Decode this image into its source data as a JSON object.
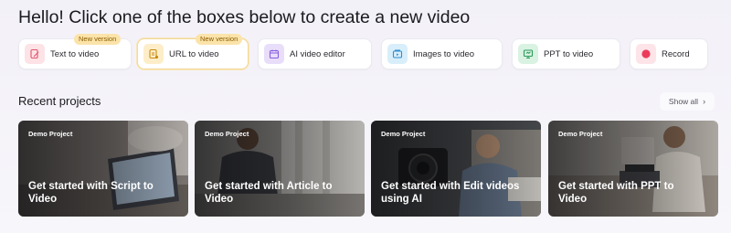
{
  "header": {
    "title": "Hello! Click one of the boxes below to create a new video"
  },
  "actions": [
    {
      "label": "Text to video",
      "icon": "document-pen-icon",
      "badge": "New version"
    },
    {
      "label": "URL to video",
      "icon": "url-document-icon",
      "badge": "New version"
    },
    {
      "label": "AI video editor",
      "icon": "ai-editor-icon"
    },
    {
      "label": "Images to video",
      "icon": "images-icon"
    },
    {
      "label": "PPT to video",
      "icon": "presentation-icon"
    },
    {
      "label": "Record",
      "icon": "record-icon"
    }
  ],
  "recent": {
    "title": "Recent projects",
    "show_all": "Show all",
    "cards": [
      {
        "tag": "Demo Project",
        "title": "Get started with Script to Video"
      },
      {
        "tag": "Demo Project",
        "title": "Get started with Article to Video"
      },
      {
        "tag": "Demo Project",
        "title": "Get started with Edit videos using AI"
      },
      {
        "tag": "Demo Project",
        "title": "Get started with PPT to Video"
      }
    ]
  },
  "colors": {
    "text_icon_bg": "#fde2e6",
    "url_icon_bg": "#fdeec9",
    "ai_icon_bg": "#e8defa",
    "images_icon_bg": "#d8eefa",
    "ppt_icon_bg": "#d9f2e2",
    "record_icon_bg": "#fde4e8",
    "badge_bg": "#fbe3a9"
  }
}
